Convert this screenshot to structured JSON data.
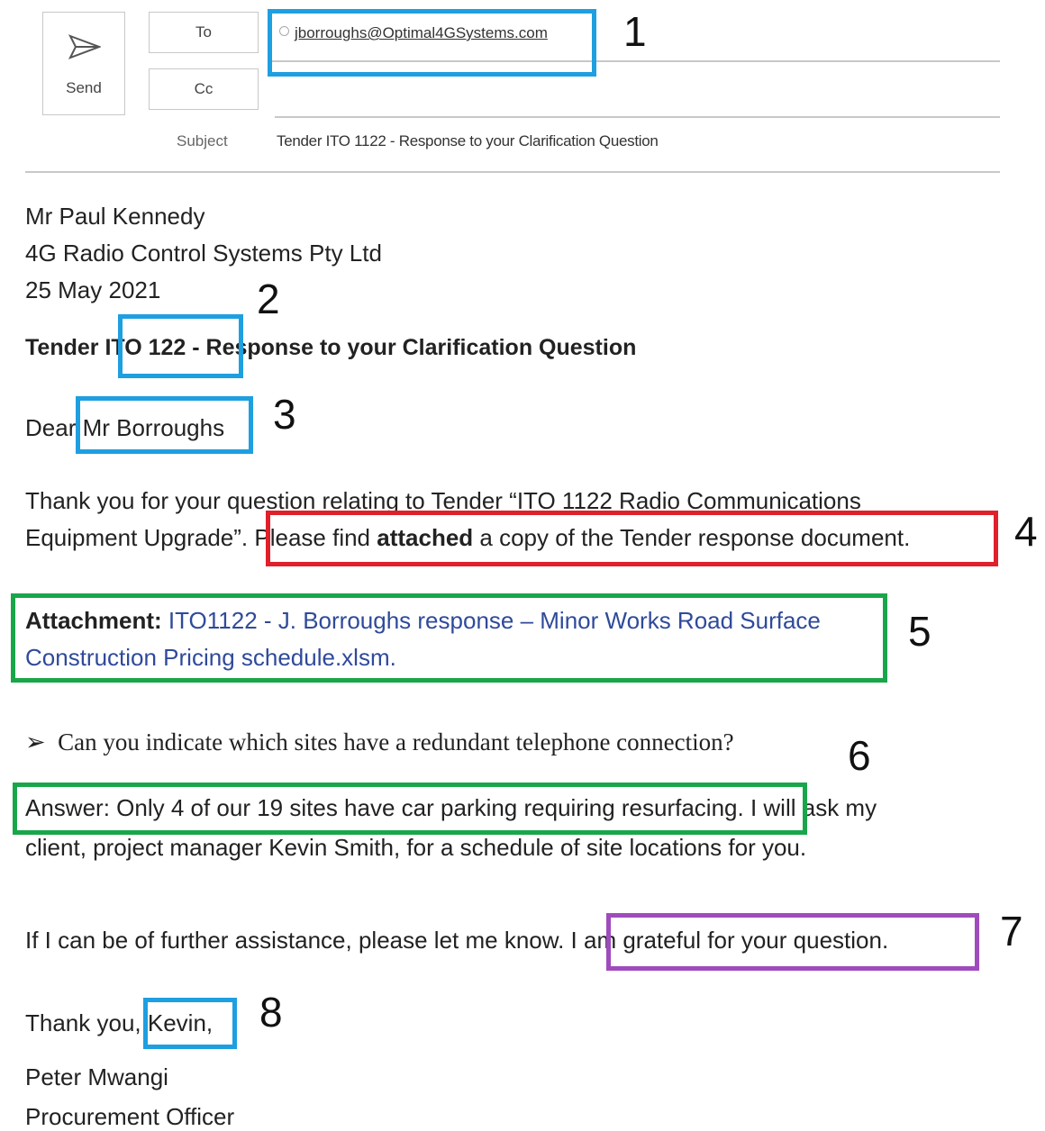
{
  "compose": {
    "send_label": "Send",
    "to_label": "To",
    "cc_label": "Cc",
    "subject_label": "Subject",
    "recipient": "jborroughs@Optimal4GSystems.com",
    "subject": "Tender ITO 1122 - Response to your Clarification Question"
  },
  "letter": {
    "sender_name": "Mr Paul Kennedy",
    "company": "4G Radio Control Systems Pty Ltd",
    "date": "25 May 2021",
    "heading": "Tender ITO 122 - Response to your Clarification Question",
    "salutation_prefix": "Dear",
    "salutation_name": "Mr Borroughs",
    "para1_line1": "Thank you for your question relating to Tender “ITO 1122 Radio Communications",
    "para1_line2_start": "Equipment Upgrade”.",
    "para1_please": "Please find ",
    "para1_attached": "attached",
    "para1_rest": " a copy of the Tender response document.",
    "attachment_label": "Attachment:",
    "attachment_line1": " ITO1122 - J. Borroughs response – Minor Works Road Surface",
    "attachment_line2": "Construction Pricing schedule.xlsm.",
    "question_bullet": "➢",
    "question": "Can you indicate which sites have a redundant telephone connection?",
    "answer": "Answer: Only 4 of our 19 sites have car parking requiring resurfacing.",
    "answer_rest": " I will ask my",
    "answer_line2": "client, project manager Kevin Smith, for a schedule of site locations for you.",
    "closing_start": "If I can be of further assistance, please let me know.",
    "closing_grateful": " I am grateful for your question.",
    "thanks": "Thank you,",
    "thanks_name": " Kevin,",
    "signature_name": "Peter Mwangi",
    "signature_title": "Procurement Officer"
  },
  "annotations": [
    "1",
    "2",
    "3",
    "4",
    "5",
    "6",
    "7",
    "8"
  ],
  "colors": {
    "blue_box": "#1e9fe0",
    "red_box": "#e0202a",
    "green_box": "#19a64a",
    "purple_box": "#a04bbd",
    "link": "#2f4a9a"
  }
}
